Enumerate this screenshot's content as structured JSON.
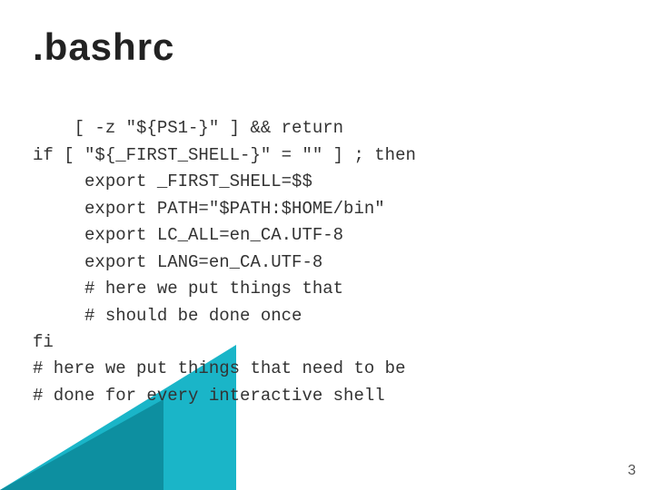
{
  "title": ".bashrc",
  "code": {
    "lines": [
      "[ -z \"${PS1-}\" ] && return",
      "if [ \"${_FIRST_SHELL-}\" = \"\" ] ; then",
      "     export _FIRST_SHELL=$$",
      "     export PATH=\"$PATH:$HOME/bin\"",
      "     export LC_ALL=en_CA.UTF-8",
      "     export LANG=en_CA.UTF-8",
      "     # here we put things that",
      "     # should be done once",
      "fi",
      "# here we put things that need to be",
      "# done for every interactive shell"
    ]
  },
  "page_number": "3"
}
